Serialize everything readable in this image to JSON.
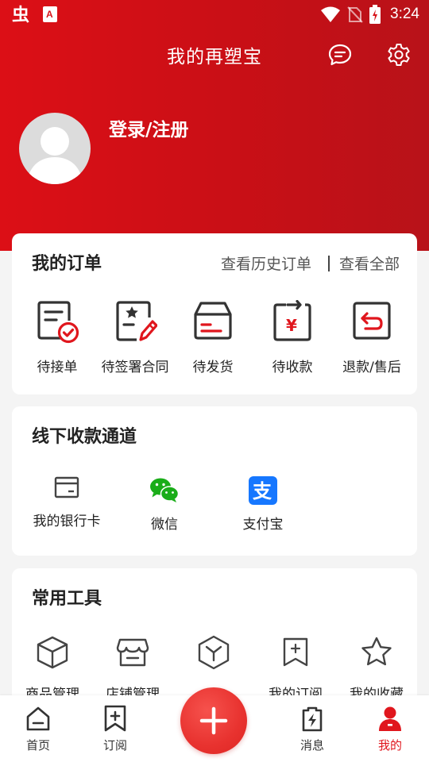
{
  "status_bar": {
    "time": "3:24",
    "icons": [
      "app-logo-icon",
      "pdf-app-icon",
      "wifi-icon",
      "no-sim-icon",
      "battery-charging-icon"
    ]
  },
  "header": {
    "title": "我的再塑宝",
    "login_text": "登录/注册",
    "icons": [
      "message-icon",
      "settings-icon"
    ]
  },
  "orders": {
    "title": "我的订单",
    "history_link": "查看历史订单",
    "all_link": "查看全部",
    "items": [
      {
        "label": "待接单",
        "icon": "pending-accept-icon"
      },
      {
        "label": "待签署合同",
        "icon": "sign-contract-icon"
      },
      {
        "label": "待发货",
        "icon": "to-ship-icon"
      },
      {
        "label": "待收款",
        "icon": "to-receive-payment-icon"
      },
      {
        "label": "退款/售后",
        "icon": "refund-icon"
      }
    ]
  },
  "offline_payment": {
    "title": "线下收款通道",
    "items": [
      {
        "label": "我的银行卡",
        "icon": "bank-card-icon"
      },
      {
        "label": "微信",
        "icon": "wechat-icon"
      },
      {
        "label": "支付宝",
        "icon": "alipay-icon"
      }
    ]
  },
  "tools": {
    "title": "常用工具",
    "items": [
      {
        "label": "商品管理",
        "icon": "product-box-icon"
      },
      {
        "label": "店铺管理",
        "icon": "store-icon"
      },
      {
        "label": "",
        "icon": "hexagon-icon"
      },
      {
        "label": "我的订阅",
        "icon": "subscribe-icon"
      },
      {
        "label": "我的收藏",
        "icon": "star-icon"
      }
    ]
  },
  "bottom_nav": {
    "items": [
      {
        "label": "首页",
        "icon": "home-icon",
        "active": false
      },
      {
        "label": "订阅",
        "icon": "subscribe-nav-icon",
        "active": false
      },
      {
        "label": "消息",
        "icon": "message-nav-icon",
        "active": false
      },
      {
        "label": "我的",
        "icon": "profile-icon",
        "active": true
      }
    ],
    "fab_icon": "plus-icon"
  },
  "colors": {
    "brand_red": "#d7141a",
    "active_red": "#e0161d",
    "wechat_green": "#1aad19",
    "alipay_blue": "#1677ff"
  }
}
